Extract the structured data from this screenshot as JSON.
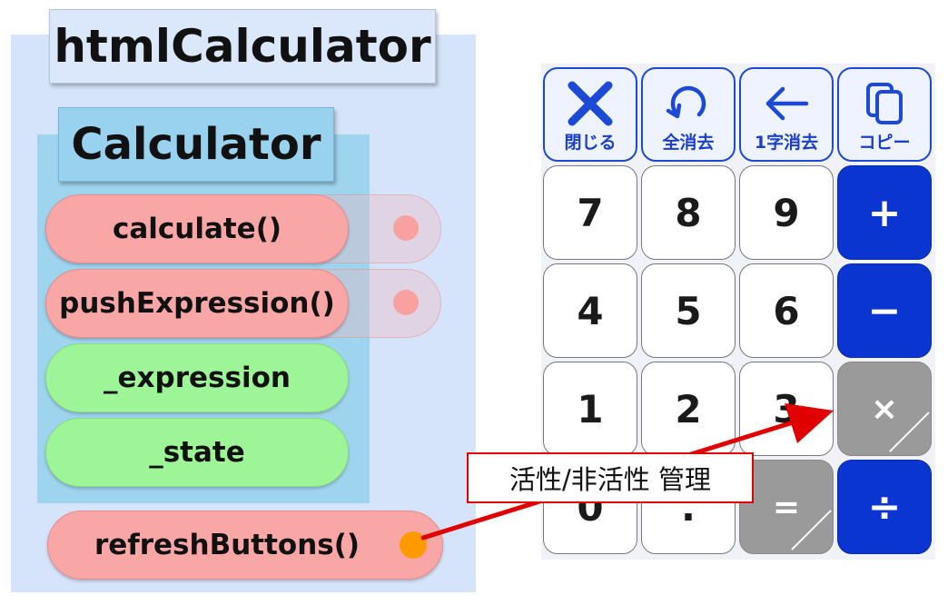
{
  "diagram": {
    "outer_title": "htmlCalculator",
    "inner_title": "Calculator",
    "methods": [
      "calculate()",
      "pushExpression()"
    ],
    "fields": [
      "_expression",
      "_state"
    ],
    "outer_method": "refreshButtons()",
    "callout": "活性/非活性 管理"
  },
  "calculator": {
    "function_keys": [
      {
        "label": "閉じる",
        "icon": "close-icon"
      },
      {
        "label": "全消去",
        "icon": "refresh-icon"
      },
      {
        "label": "1字消去",
        "icon": "back-arrow-icon"
      },
      {
        "label": "コピー",
        "icon": "copy-icon"
      }
    ],
    "rows": [
      [
        "7",
        "8",
        "9",
        "+"
      ],
      [
        "4",
        "5",
        "6",
        "−"
      ],
      [
        "1",
        "2",
        "3",
        "×"
      ],
      [
        "0",
        ".",
        "=",
        "÷"
      ]
    ]
  },
  "colors": {
    "outer_bg": "#d6e4fb",
    "inner_bg": "#9fd4ef",
    "method_pill": "#f9a6a6",
    "field_pill": "#9ef598",
    "operator_active": "#0a35d0",
    "operator_disabled": "#9a9a9a",
    "arrow": "#e00000",
    "dot": "#ff9900"
  }
}
